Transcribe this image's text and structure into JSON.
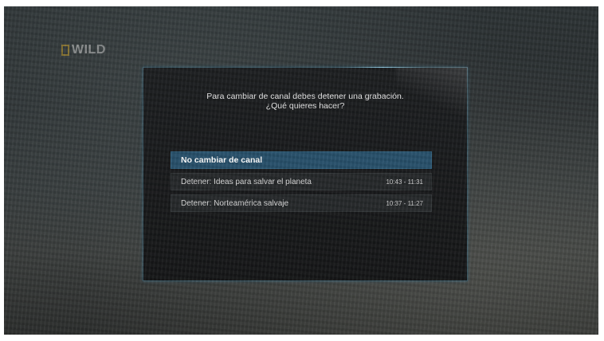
{
  "background": {
    "channel_logo": "WILD"
  },
  "dialog": {
    "message_line1": "Para cambiar de canal debes detener una grabación.",
    "message_line2": "¿Qué quieres hacer?",
    "options": [
      {
        "label": "No cambiar de canal",
        "time": "",
        "selected": true
      },
      {
        "label": "Detener: Ideas para salvar el planeta",
        "time": "10:43 - 11:31",
        "selected": false
      },
      {
        "label": "Detener: Norteamérica salvaje",
        "time": "10:37 - 11:27",
        "selected": false
      }
    ]
  },
  "colors": {
    "selected_option": "#27506a",
    "dialog_border": "#3d5a66",
    "logo_accent": "#c9a02a"
  }
}
